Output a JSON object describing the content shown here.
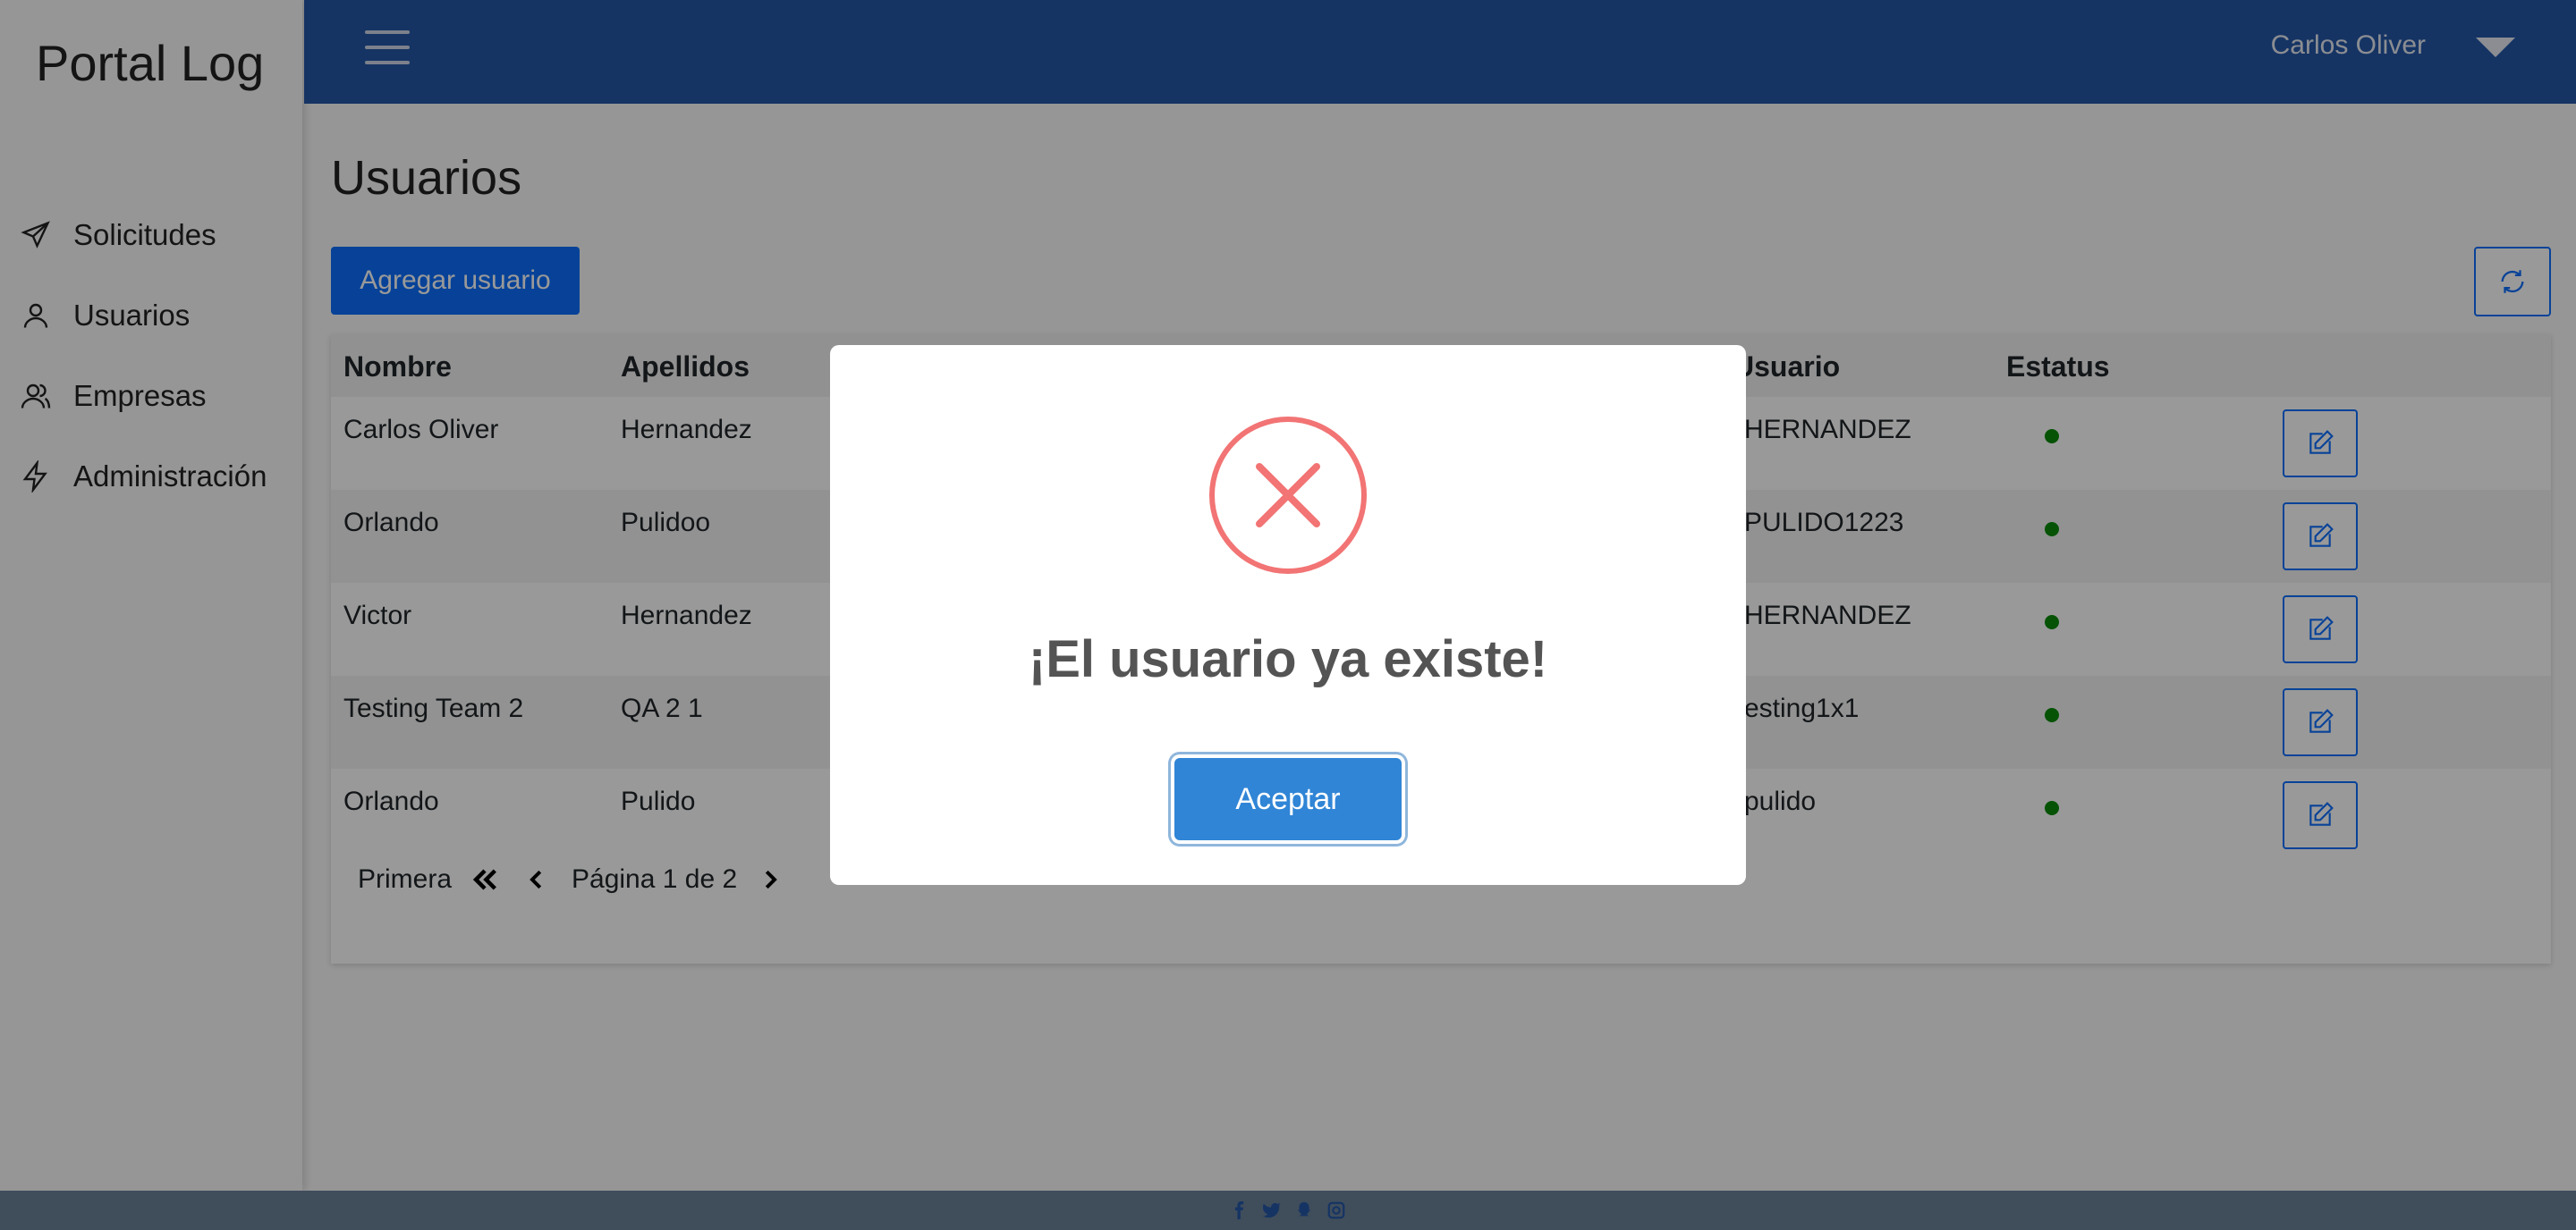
{
  "app": {
    "brand": "Portal Log"
  },
  "sidebar": {
    "items": [
      {
        "label": "Solicitudes",
        "icon": "plane-icon"
      },
      {
        "label": "Usuarios",
        "icon": "user-icon"
      },
      {
        "label": "Empresas",
        "icon": "users-icon"
      },
      {
        "label": "Administración",
        "icon": "bolt-icon"
      }
    ]
  },
  "topbar": {
    "user_name": "Carlos Oliver"
  },
  "main": {
    "title": "Usuarios",
    "add_button": "Agregar usuario",
    "table": {
      "headers": [
        "Nombre",
        "Apellidos",
        "Usuario",
        "Estatus"
      ],
      "rows": [
        {
          "nombre": "Carlos Oliver",
          "apellidos": "Hernandez",
          "usuario": "HERNANDEZ",
          "estatus": "active"
        },
        {
          "nombre": "Orlando",
          "apellidos": "Pulidoo",
          "usuario": "PULIDO1223",
          "estatus": "active"
        },
        {
          "nombre": "Victor",
          "apellidos": "Hernandez",
          "usuario": "HERNANDEZ",
          "estatus": "active"
        },
        {
          "nombre": "Testing Team 2",
          "apellidos": "QA 2 1",
          "usuario": "esting1x1",
          "estatus": "active"
        },
        {
          "nombre": "Orlando",
          "apellidos": "Pulido",
          "usuario": "pulido",
          "estatus": "active"
        }
      ]
    },
    "pager": {
      "first": "Primera",
      "page_text": "Página 1 de 2"
    }
  },
  "modal": {
    "title": "¡El usuario ya existe!",
    "confirm": "Aceptar",
    "icon": "error-x-icon"
  },
  "colors": {
    "topbar": "#2457a7",
    "primary": "#0d6efd",
    "confirm": "#3085d6",
    "error": "#f27474",
    "status_active": "#0a8a0a"
  }
}
